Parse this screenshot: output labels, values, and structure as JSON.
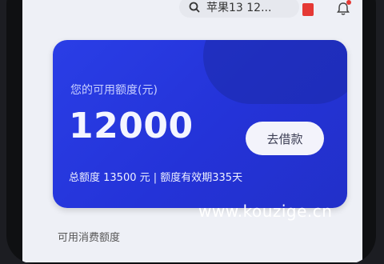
{
  "search": {
    "text": "苹果13 12..."
  },
  "card": {
    "available_label": "您的可用额度(元)",
    "amount": "12000",
    "borrow_button": "去借款",
    "footer": "总额度 13500 元 | 额度有效期335天"
  },
  "section": {
    "partial_label": "可用消费额度"
  },
  "watermark": "www.kouzige.cn",
  "colors": {
    "card": "#2a3ee6",
    "badge": "#e53935"
  },
  "icons": {
    "search": "search-icon",
    "bell": "bell-icon",
    "app": "app-icon"
  }
}
